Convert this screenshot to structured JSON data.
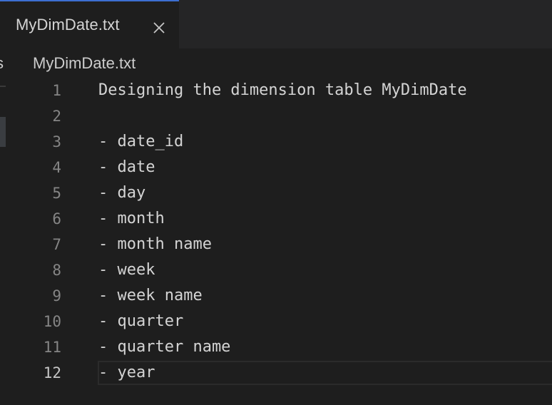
{
  "tab": {
    "label": "MyDimDate.txt",
    "close_icon": "close-icon"
  },
  "breadcrumb": "MyDimDate.txt",
  "left_strip_glyph": "s",
  "lines": [
    {
      "number": "1",
      "text": "Designing the dimension table MyDimDate"
    },
    {
      "number": "2",
      "text": ""
    },
    {
      "number": "3",
      "text": "- date_id"
    },
    {
      "number": "4",
      "text": "- date"
    },
    {
      "number": "5",
      "text": "- day"
    },
    {
      "number": "6",
      "text": "- month"
    },
    {
      "number": "7",
      "text": "- month name"
    },
    {
      "number": "8",
      "text": "- week"
    },
    {
      "number": "9",
      "text": "- week name"
    },
    {
      "number": "10",
      "text": "- quarter"
    },
    {
      "number": "11",
      "text": "- quarter name"
    },
    {
      "number": "12",
      "text": "- year"
    }
  ],
  "current_line": "12",
  "colors": {
    "background": "#1e1e1e",
    "tabbar": "#252526",
    "active_tab_border": "#3c6fd1",
    "text": "#d4d4d4",
    "line_number": "#858585"
  }
}
